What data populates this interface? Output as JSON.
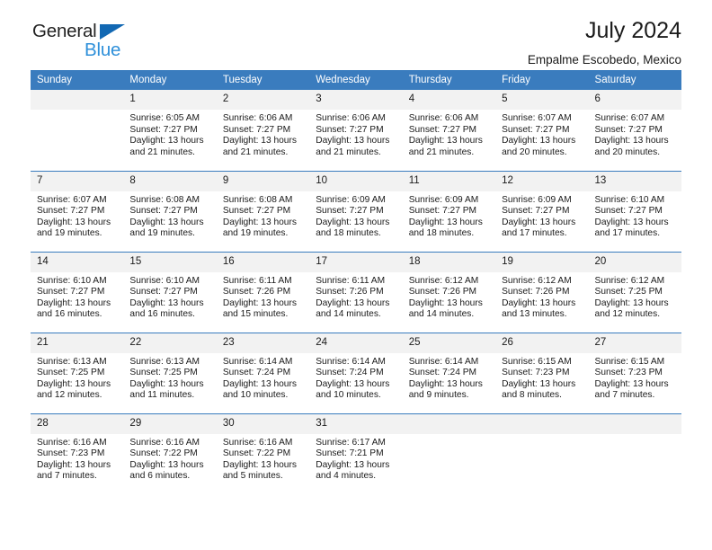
{
  "logo": {
    "word1": "General",
    "word2": "Blue",
    "triangle_color": "#1268b3",
    "word2_color": "#2f90da"
  },
  "header": {
    "title": "July 2024",
    "subtitle": "Empalme Escobedo, Mexico"
  },
  "theme": {
    "header_row_bg": "#3a7cbe",
    "header_row_text": "#ffffff",
    "daynum_bg": "#f2f2f2",
    "separator": "#3a7cbe"
  },
  "weekday_headers": [
    "Sunday",
    "Monday",
    "Tuesday",
    "Wednesday",
    "Thursday",
    "Friday",
    "Saturday"
  ],
  "weeks": [
    [
      {
        "day": "",
        "sunrise": "",
        "sunset": "",
        "daylight1": "",
        "daylight2": ""
      },
      {
        "day": "1",
        "sunrise": "Sunrise: 6:05 AM",
        "sunset": "Sunset: 7:27 PM",
        "daylight1": "Daylight: 13 hours",
        "daylight2": "and 21 minutes."
      },
      {
        "day": "2",
        "sunrise": "Sunrise: 6:06 AM",
        "sunset": "Sunset: 7:27 PM",
        "daylight1": "Daylight: 13 hours",
        "daylight2": "and 21 minutes."
      },
      {
        "day": "3",
        "sunrise": "Sunrise: 6:06 AM",
        "sunset": "Sunset: 7:27 PM",
        "daylight1": "Daylight: 13 hours",
        "daylight2": "and 21 minutes."
      },
      {
        "day": "4",
        "sunrise": "Sunrise: 6:06 AM",
        "sunset": "Sunset: 7:27 PM",
        "daylight1": "Daylight: 13 hours",
        "daylight2": "and 21 minutes."
      },
      {
        "day": "5",
        "sunrise": "Sunrise: 6:07 AM",
        "sunset": "Sunset: 7:27 PM",
        "daylight1": "Daylight: 13 hours",
        "daylight2": "and 20 minutes."
      },
      {
        "day": "6",
        "sunrise": "Sunrise: 6:07 AM",
        "sunset": "Sunset: 7:27 PM",
        "daylight1": "Daylight: 13 hours",
        "daylight2": "and 20 minutes."
      }
    ],
    [
      {
        "day": "7",
        "sunrise": "Sunrise: 6:07 AM",
        "sunset": "Sunset: 7:27 PM",
        "daylight1": "Daylight: 13 hours",
        "daylight2": "and 19 minutes."
      },
      {
        "day": "8",
        "sunrise": "Sunrise: 6:08 AM",
        "sunset": "Sunset: 7:27 PM",
        "daylight1": "Daylight: 13 hours",
        "daylight2": "and 19 minutes."
      },
      {
        "day": "9",
        "sunrise": "Sunrise: 6:08 AM",
        "sunset": "Sunset: 7:27 PM",
        "daylight1": "Daylight: 13 hours",
        "daylight2": "and 19 minutes."
      },
      {
        "day": "10",
        "sunrise": "Sunrise: 6:09 AM",
        "sunset": "Sunset: 7:27 PM",
        "daylight1": "Daylight: 13 hours",
        "daylight2": "and 18 minutes."
      },
      {
        "day": "11",
        "sunrise": "Sunrise: 6:09 AM",
        "sunset": "Sunset: 7:27 PM",
        "daylight1": "Daylight: 13 hours",
        "daylight2": "and 18 minutes."
      },
      {
        "day": "12",
        "sunrise": "Sunrise: 6:09 AM",
        "sunset": "Sunset: 7:27 PM",
        "daylight1": "Daylight: 13 hours",
        "daylight2": "and 17 minutes."
      },
      {
        "day": "13",
        "sunrise": "Sunrise: 6:10 AM",
        "sunset": "Sunset: 7:27 PM",
        "daylight1": "Daylight: 13 hours",
        "daylight2": "and 17 minutes."
      }
    ],
    [
      {
        "day": "14",
        "sunrise": "Sunrise: 6:10 AM",
        "sunset": "Sunset: 7:27 PM",
        "daylight1": "Daylight: 13 hours",
        "daylight2": "and 16 minutes."
      },
      {
        "day": "15",
        "sunrise": "Sunrise: 6:10 AM",
        "sunset": "Sunset: 7:27 PM",
        "daylight1": "Daylight: 13 hours",
        "daylight2": "and 16 minutes."
      },
      {
        "day": "16",
        "sunrise": "Sunrise: 6:11 AM",
        "sunset": "Sunset: 7:26 PM",
        "daylight1": "Daylight: 13 hours",
        "daylight2": "and 15 minutes."
      },
      {
        "day": "17",
        "sunrise": "Sunrise: 6:11 AM",
        "sunset": "Sunset: 7:26 PM",
        "daylight1": "Daylight: 13 hours",
        "daylight2": "and 14 minutes."
      },
      {
        "day": "18",
        "sunrise": "Sunrise: 6:12 AM",
        "sunset": "Sunset: 7:26 PM",
        "daylight1": "Daylight: 13 hours",
        "daylight2": "and 14 minutes."
      },
      {
        "day": "19",
        "sunrise": "Sunrise: 6:12 AM",
        "sunset": "Sunset: 7:26 PM",
        "daylight1": "Daylight: 13 hours",
        "daylight2": "and 13 minutes."
      },
      {
        "day": "20",
        "sunrise": "Sunrise: 6:12 AM",
        "sunset": "Sunset: 7:25 PM",
        "daylight1": "Daylight: 13 hours",
        "daylight2": "and 12 minutes."
      }
    ],
    [
      {
        "day": "21",
        "sunrise": "Sunrise: 6:13 AM",
        "sunset": "Sunset: 7:25 PM",
        "daylight1": "Daylight: 13 hours",
        "daylight2": "and 12 minutes."
      },
      {
        "day": "22",
        "sunrise": "Sunrise: 6:13 AM",
        "sunset": "Sunset: 7:25 PM",
        "daylight1": "Daylight: 13 hours",
        "daylight2": "and 11 minutes."
      },
      {
        "day": "23",
        "sunrise": "Sunrise: 6:14 AM",
        "sunset": "Sunset: 7:24 PM",
        "daylight1": "Daylight: 13 hours",
        "daylight2": "and 10 minutes."
      },
      {
        "day": "24",
        "sunrise": "Sunrise: 6:14 AM",
        "sunset": "Sunset: 7:24 PM",
        "daylight1": "Daylight: 13 hours",
        "daylight2": "and 10 minutes."
      },
      {
        "day": "25",
        "sunrise": "Sunrise: 6:14 AM",
        "sunset": "Sunset: 7:24 PM",
        "daylight1": "Daylight: 13 hours",
        "daylight2": "and 9 minutes."
      },
      {
        "day": "26",
        "sunrise": "Sunrise: 6:15 AM",
        "sunset": "Sunset: 7:23 PM",
        "daylight1": "Daylight: 13 hours",
        "daylight2": "and 8 minutes."
      },
      {
        "day": "27",
        "sunrise": "Sunrise: 6:15 AM",
        "sunset": "Sunset: 7:23 PM",
        "daylight1": "Daylight: 13 hours",
        "daylight2": "and 7 minutes."
      }
    ],
    [
      {
        "day": "28",
        "sunrise": "Sunrise: 6:16 AM",
        "sunset": "Sunset: 7:23 PM",
        "daylight1": "Daylight: 13 hours",
        "daylight2": "and 7 minutes."
      },
      {
        "day": "29",
        "sunrise": "Sunrise: 6:16 AM",
        "sunset": "Sunset: 7:22 PM",
        "daylight1": "Daylight: 13 hours",
        "daylight2": "and 6 minutes."
      },
      {
        "day": "30",
        "sunrise": "Sunrise: 6:16 AM",
        "sunset": "Sunset: 7:22 PM",
        "daylight1": "Daylight: 13 hours",
        "daylight2": "and 5 minutes."
      },
      {
        "day": "31",
        "sunrise": "Sunrise: 6:17 AM",
        "sunset": "Sunset: 7:21 PM",
        "daylight1": "Daylight: 13 hours",
        "daylight2": "and 4 minutes."
      },
      {
        "day": "",
        "sunrise": "",
        "sunset": "",
        "daylight1": "",
        "daylight2": ""
      },
      {
        "day": "",
        "sunrise": "",
        "sunset": "",
        "daylight1": "",
        "daylight2": ""
      },
      {
        "day": "",
        "sunrise": "",
        "sunset": "",
        "daylight1": "",
        "daylight2": ""
      }
    ]
  ]
}
